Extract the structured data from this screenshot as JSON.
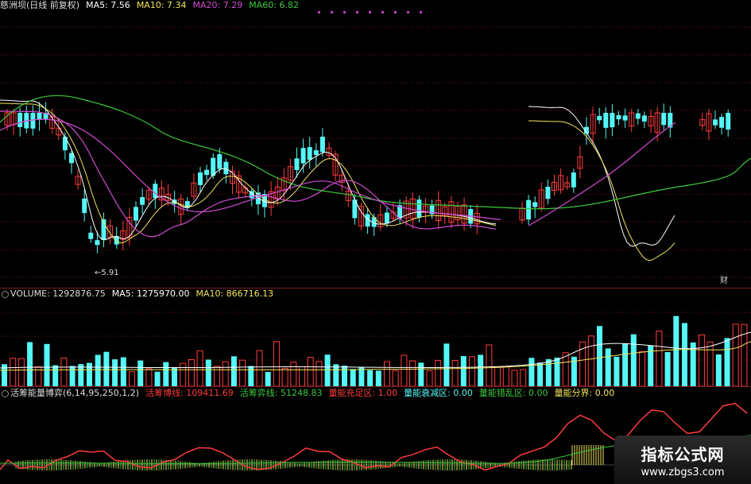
{
  "main_header": {
    "title": "慈洲坝(日线 前复权)",
    "ma5": "MA5: 7.56",
    "ma10": "MA10: 7.34",
    "ma20": "MA20: 7.29",
    "ma60": "MA60: 6.82"
  },
  "main_annotations": {
    "low_label": "5.91",
    "side_label": "财"
  },
  "volume_header": {
    "volume": "VOLUME: 1292876.75",
    "ma5": "MA5: 1275970.00",
    "ma10": "MA10: 866716.13"
  },
  "indicator_header": {
    "name": "活筹能量博弈(6,14,95,250,1,2)",
    "active_line": "活筹博线: 109411.69",
    "active_chip": "活筹弈线: 51248.83",
    "energy_full": "量能充足区: 1.00",
    "energy_decay": "量能衰减区: 0.00",
    "energy_chaos": "量能错乱区: 0.00",
    "energy_bound": "量能分界: 0.00"
  },
  "watermark": {
    "line1": "指标公式网",
    "line2": "www.zbgs3.com"
  },
  "colors": {
    "up": "#ff3c3c",
    "down": "#54f6f6",
    "ma5": "#ffffff",
    "ma10": "#f2e45a",
    "ma20": "#d24ad2",
    "ma60": "#3cc83c",
    "grid": "#7a1a1a"
  },
  "chart_data": [
    {
      "type": "candlestick",
      "title": "慈洲坝(日线 前复权)",
      "series": [
        {
          "name": "MA5",
          "values": [
            7.56
          ]
        },
        {
          "name": "MA10",
          "values": [
            7.34
          ]
        },
        {
          "name": "MA20",
          "values": [
            7.29
          ]
        },
        {
          "name": "MA60",
          "values": [
            6.82
          ]
        }
      ],
      "annotations": [
        "5.91"
      ]
    },
    {
      "type": "bar",
      "title": "VOLUME",
      "series": [
        {
          "name": "VOLUME",
          "values": [
            1292876.75
          ]
        },
        {
          "name": "MA5",
          "values": [
            1275970.0
          ]
        },
        {
          "name": "MA10",
          "values": [
            866716.13
          ]
        }
      ]
    },
    {
      "type": "line",
      "title": "活筹能量博弈(6,14,95,250,1,2)",
      "series": [
        {
          "name": "活筹博线",
          "values": [
            109411.69
          ]
        },
        {
          "name": "活筹弈线",
          "values": [
            51248.83
          ]
        },
        {
          "name": "量能充足区",
          "values": [
            1.0
          ]
        },
        {
          "name": "量能衰减区",
          "values": [
            0.0
          ]
        },
        {
          "name": "量能错乱区",
          "values": [
            0.0
          ]
        },
        {
          "name": "量能分界",
          "values": [
            0.0
          ]
        }
      ]
    }
  ]
}
